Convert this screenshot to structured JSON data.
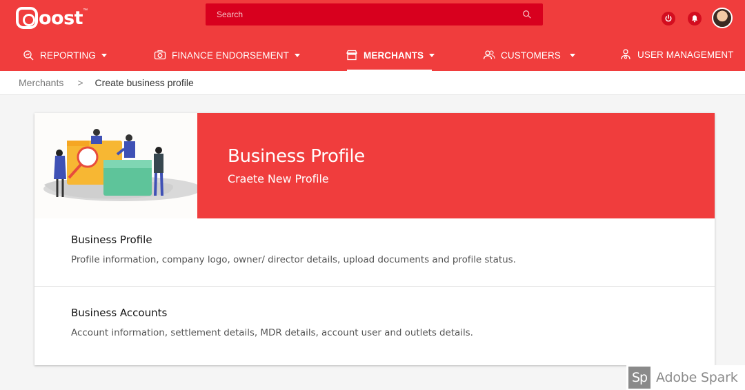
{
  "app": {
    "logo_text": "oost",
    "logo_tm": "™",
    "brand_color": "#f03d3d"
  },
  "search": {
    "placeholder": "Search",
    "icon": "search-icon"
  },
  "header_icons": [
    "power-icon",
    "bell-icon",
    "avatar"
  ],
  "nav": {
    "items": [
      {
        "label": "REPORTING",
        "icon": "reporting-icon",
        "has_dropdown": true
      },
      {
        "label": "FINANCE ENDORSEMENT",
        "icon": "camera-icon",
        "has_dropdown": true
      },
      {
        "label": "MERCHANTS",
        "icon": "store-icon",
        "has_dropdown": true,
        "active": true
      },
      {
        "label": "CUSTOMERS",
        "icon": "users-icon",
        "has_dropdown": true
      },
      {
        "label": "USER MANAGEMENT",
        "icon": "user-gear-icon",
        "has_dropdown": false
      }
    ]
  },
  "breadcrumb": {
    "parent": "Merchants",
    "separator": ">",
    "current": "Create business profile"
  },
  "card": {
    "hero_title": "Business Profile",
    "hero_subtitle": "Craete New Profile",
    "sections": [
      {
        "title": "Business Profile",
        "description": "Profile information, company logo, owner/ director details, upload documents and profile status."
      },
      {
        "title": "Business Accounts",
        "description": "Account information, settlement details, MDR details, account user and outlets details."
      }
    ]
  },
  "watermark": {
    "badge": "Sp",
    "text": "Adobe Spark"
  }
}
